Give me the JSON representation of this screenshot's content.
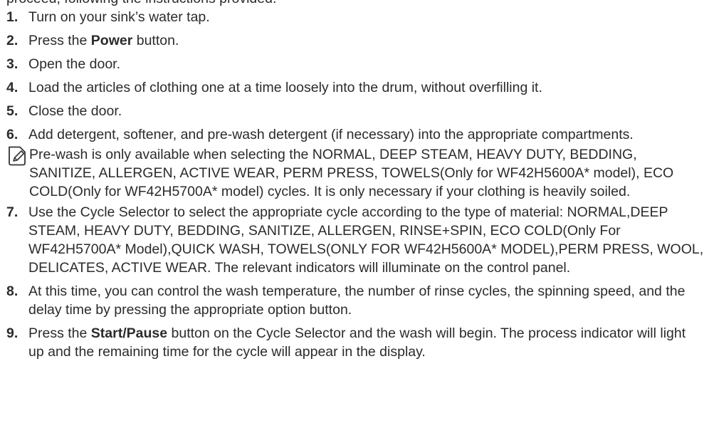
{
  "top_fragment": "proceed, following the instructions provided.",
  "steps": [
    {
      "num": "1.",
      "text": "Turn on your sink’s water tap."
    },
    {
      "num": "2.",
      "before": "Press the ",
      "bold": "Power",
      "after": " button."
    },
    {
      "num": "3.",
      "text": "Open the door."
    },
    {
      "num": "4.",
      "text": "Load the articles of clothing one at a time loosely into the drum, without overfilling it."
    },
    {
      "num": "5.",
      "text": "Close the door."
    },
    {
      "num": "6.",
      "text": "Add detergent, softener, and pre-wash detergent (if necessary) into the appropriate compartments."
    },
    {
      "num": "7.",
      "text": "Use the Cycle Selector to select the appropriate cycle according to the type of material: NORMAL,DEEP STEAM, HEAVY DUTY, BEDDING, SANITIZE, ALLERGEN, RINSE+SPIN, ECO COLD(Only For WF42H5700A* Model),QUICK WASH, TOWELS(ONLY FOR WF42H5600A* MODEL),PERM PRESS, WOOL, DELICATES, ACTIVE WEAR. The relevant indicators will illuminate on the control panel."
    },
    {
      "num": "8.",
      "text": "At this time, you can control the wash temperature, the number of rinse cycles, the spinning speed, and the delay time by pressing the appropriate option button."
    },
    {
      "num": "9.",
      "before": "Press the ",
      "bold": "Start/Pause",
      "after": " button on the Cycle Selector and the wash will begin. The process indicator will light up and the remaining time for the cycle will appear in the display."
    }
  ],
  "note": {
    "icon": "note-pencil-icon",
    "text": "Pre-wash is only available when selecting the NORMAL, DEEP STEAM, HEAVY DUTY, BEDDING, SANITIZE, ALLERGEN, ACTIVE WEAR, PERM PRESS, TOWELS(Only for WF42H5600A* model), ECO COLD(Only for WF42H5700A* model) cycles. It is only necessary if your clothing is heavily soiled."
  }
}
